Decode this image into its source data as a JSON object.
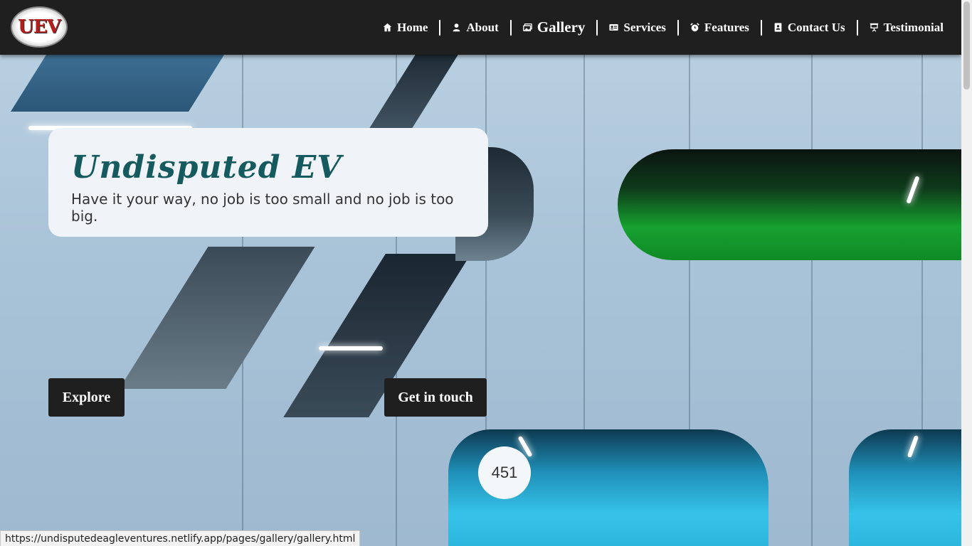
{
  "brand": {
    "logo_text": "UEV"
  },
  "nav": {
    "items": [
      {
        "label": "Home",
        "icon": "home-icon"
      },
      {
        "label": "About",
        "icon": "person-icon"
      },
      {
        "label": "Gallery",
        "icon": "images-icon",
        "active": true
      },
      {
        "label": "Services",
        "icon": "id-card-icon"
      },
      {
        "label": "Features",
        "icon": "alarm-icon"
      },
      {
        "label": "Contact Us",
        "icon": "contact-book-icon"
      },
      {
        "label": "Testimonial",
        "icon": "presentation-icon"
      }
    ]
  },
  "hero": {
    "title": "Undisputed EV",
    "subtitle": "Have it your way, no job is too small and no job is too big.",
    "buttons": {
      "explore": "Explore",
      "contact": "Get in touch"
    },
    "background_room_number": "451"
  },
  "status_bar": {
    "url": "https://undisputedeagleventures.netlify.app/pages/gallery/gallery.html"
  },
  "colors": {
    "nav_bg": "#1f1f1f",
    "title": "#145a5e",
    "card_bg": "#f0f4f8"
  }
}
